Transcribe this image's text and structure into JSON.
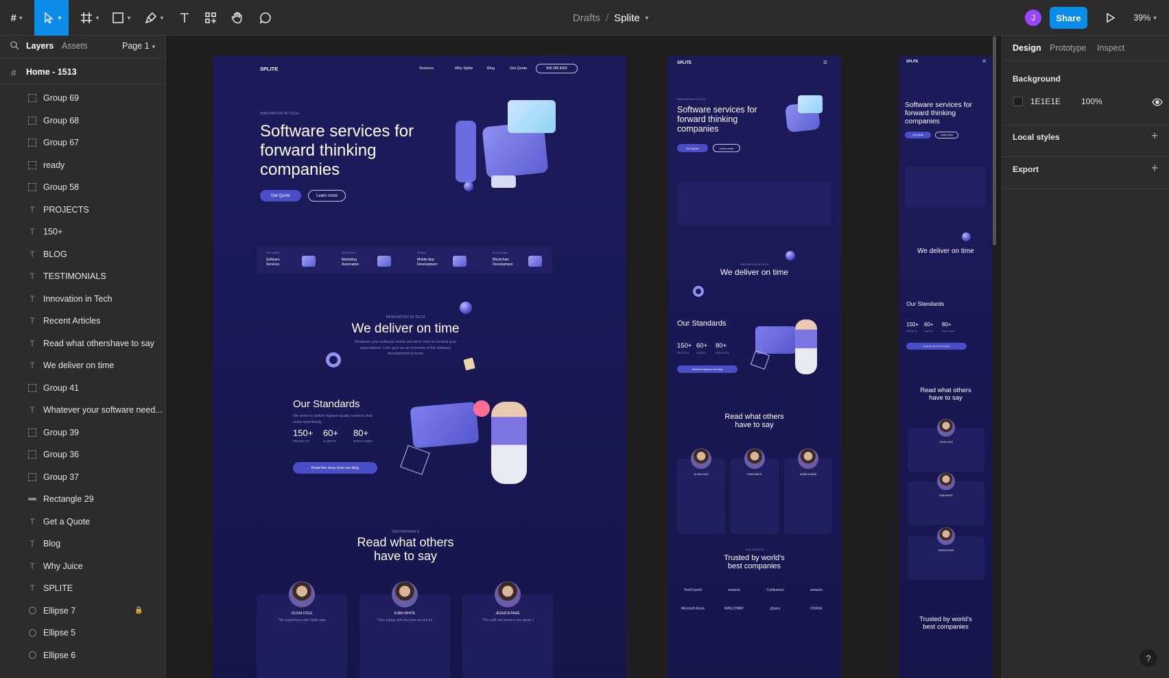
{
  "toolbar": {
    "breadcrumb_parent": "Drafts",
    "breadcrumb_sep": "/",
    "file_name": "Splite",
    "avatar_initial": "J",
    "share_label": "Share",
    "zoom": "39%"
  },
  "left_panel": {
    "tabs": [
      "Layers",
      "Assets"
    ],
    "page_select": "Page 1",
    "frame_title": "Home - 1513",
    "layers": [
      {
        "name": "Group 69",
        "type": "group"
      },
      {
        "name": "Group 68",
        "type": "group"
      },
      {
        "name": "Group 67",
        "type": "group"
      },
      {
        "name": "ready",
        "type": "group"
      },
      {
        "name": "Group 58",
        "type": "group"
      },
      {
        "name": "PROJECTS",
        "type": "text"
      },
      {
        "name": "150+",
        "type": "text"
      },
      {
        "name": "BLOG",
        "type": "text"
      },
      {
        "name": "TESTIMONIALS",
        "type": "text"
      },
      {
        "name": "Innovation in Tech",
        "type": "text"
      },
      {
        "name": "Recent Articles",
        "type": "text"
      },
      {
        "name": "Read what othershave to say",
        "type": "text"
      },
      {
        "name": "We deliver on time",
        "type": "text"
      },
      {
        "name": "Group 41",
        "type": "group"
      },
      {
        "name": "Whatever your software need...",
        "type": "text"
      },
      {
        "name": "Group 39",
        "type": "group"
      },
      {
        "name": "Group 36",
        "type": "group"
      },
      {
        "name": "Group 37",
        "type": "group"
      },
      {
        "name": "Rectangle 29",
        "type": "rect"
      },
      {
        "name": "Get a Quote",
        "type": "text"
      },
      {
        "name": "Blog",
        "type": "text"
      },
      {
        "name": "Why Juice",
        "type": "text"
      },
      {
        "name": "SPLITE",
        "type": "text"
      },
      {
        "name": "Ellipse 7",
        "type": "ellipse",
        "locked": true
      },
      {
        "name": "Ellipse 5",
        "type": "ellipse"
      },
      {
        "name": "Ellipse 6",
        "type": "ellipse"
      }
    ]
  },
  "right_panel": {
    "tabs": [
      "Design",
      "Prototype",
      "Inspect"
    ],
    "background_label": "Background",
    "background_hex": "1E1E1E",
    "background_opacity": "100%",
    "local_styles_label": "Local styles",
    "export_label": "Export",
    "help": "?"
  },
  "site": {
    "logo": "SPLITE",
    "nav": [
      "Services",
      "Why Splite",
      "Blog",
      "Get Quote"
    ],
    "phone": "858 280 8065",
    "eyebrow": "INNOVATION IN TECH",
    "hero_title": [
      "Software services for",
      "forward thinking",
      "companies"
    ],
    "btn_quote": "Get Quote",
    "btn_learn": "Learn more",
    "services": [
      {
        "cat": "SOFTWARE",
        "l1": "Software",
        "l2": "Services"
      },
      {
        "cat": "MARKETING",
        "l1": "Marketing",
        "l2": "Automation"
      },
      {
        "cat": "MOBILE",
        "l1": "Mobile App",
        "l2": "Development"
      },
      {
        "cat": "BLOCKCHAIN",
        "l1": "Blockchain",
        "l2": "Development"
      }
    ],
    "deliver_eyebrow": "INNOVATION IN TECH",
    "deliver_title": "We deliver on time",
    "deliver_text": [
      "Whatever your software needs are we're here to exceed your",
      "expectations. Let's give us an overview of the software",
      "development process"
    ],
    "standards_title": "Our Standards",
    "standards_text": [
      "We strive to deliver highest quality services that",
      "scale seamlessly"
    ],
    "stats": [
      {
        "value": "150+",
        "label": "PROJECTS"
      },
      {
        "value": "60+",
        "label": "CLIENTS"
      },
      {
        "value": "80+",
        "label": "EMPLOYEES"
      }
    ],
    "blog_btn": "Read the story from our blog",
    "testimonials_eyebrow": "TESTIMONIALS",
    "testimonials_title": [
      "Read what others",
      "have to say"
    ],
    "people": [
      {
        "name": "OLIVIA COLE",
        "quote": "\"My experience with Splite was"
      },
      {
        "name": "EVAN WHITE",
        "quote": "\"Very happy with the price we got for"
      },
      {
        "name": "JESSICA PAGE",
        "quote": "\"The staff and service was great. I"
      }
    ],
    "clients_eyebrow": "OUR CLIENTS",
    "trusted_title": [
      "Trusted by world's",
      "best companies"
    ],
    "logos": [
      "TechCrunch",
      "amazon",
      "Confluence",
      "amazon",
      "Microsoft Azure",
      "MAILCHIMP",
      "jQuery",
      "CHASE"
    ]
  }
}
